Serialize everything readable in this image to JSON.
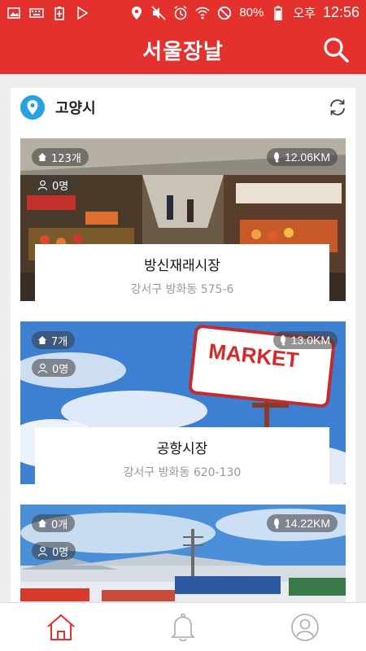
{
  "status_bar": {
    "battery": "80%",
    "ampm": "오후",
    "time": "12:56",
    "icons": [
      "image-icon",
      "keyboard-icon",
      "battery-saver-icon",
      "play-icon",
      "location-icon",
      "mute-icon",
      "alarm-icon",
      "wifi-icon",
      "block-icon",
      "battery-icon"
    ]
  },
  "app_bar": {
    "title": "서울장날",
    "search_icon": "search-icon"
  },
  "location": {
    "name": "고양시",
    "pin_icon": "location-pin-icon",
    "refresh_icon": "refresh-icon"
  },
  "markets": [
    {
      "count": "123개",
      "people": "0명",
      "distance": "12.06KM",
      "name": "방신재래시장",
      "address": "강서구 방화동 575-6"
    },
    {
      "count": "7개",
      "people": "0명",
      "distance": "13.0KM",
      "name": "공항시장",
      "address": "강서구 방화동 620-130",
      "sign_text": "MARKET"
    },
    {
      "count": "0개",
      "people": "0명",
      "distance": "14.22KM"
    }
  ],
  "bottom_nav": [
    "home-icon",
    "bell-icon",
    "profile-icon"
  ],
  "colors": {
    "brand": "#e5312e",
    "pin": "#2aa1e0"
  }
}
